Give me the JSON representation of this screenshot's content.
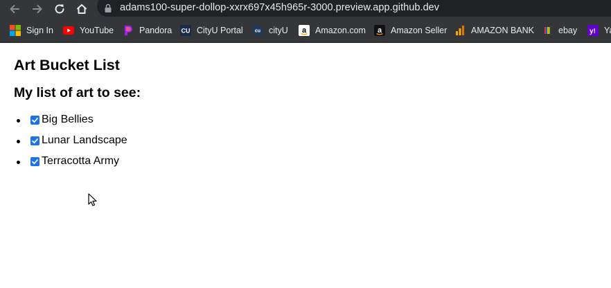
{
  "browser": {
    "url": "adams100-super-dollop-xxrx697x45h965r-3000.preview.app.github.dev",
    "bookmarks": [
      {
        "label": "Sign In",
        "icon": "microsoft-icon"
      },
      {
        "label": "YouTube",
        "icon": "youtube-icon"
      },
      {
        "label": "Pandora",
        "icon": "pandora-icon"
      },
      {
        "label": "CityU Portal",
        "icon": "cityu-portal-icon"
      },
      {
        "label": "cityU",
        "icon": "cityu-icon"
      },
      {
        "label": "Amazon.com",
        "icon": "amazon-icon"
      },
      {
        "label": "Amazon Seller",
        "icon": "amazon-icon"
      },
      {
        "label": "AMAZON BANK",
        "icon": "analytics-icon"
      },
      {
        "label": "ebay",
        "icon": "ebay-icon"
      },
      {
        "label": "Ya",
        "icon": "yahoo-icon"
      }
    ]
  },
  "page": {
    "title": "Art Bucket List",
    "subtitle": "My list of art to see:",
    "items": [
      {
        "label": "Big Bellies",
        "checked": true
      },
      {
        "label": "Lunar Landscape",
        "checked": true
      },
      {
        "label": "Terracotta Army",
        "checked": true
      }
    ]
  },
  "colors": {
    "chrome_bg": "#35363a",
    "omnibox_bg": "#202124",
    "checkbox_accent": "#1a73e8"
  }
}
